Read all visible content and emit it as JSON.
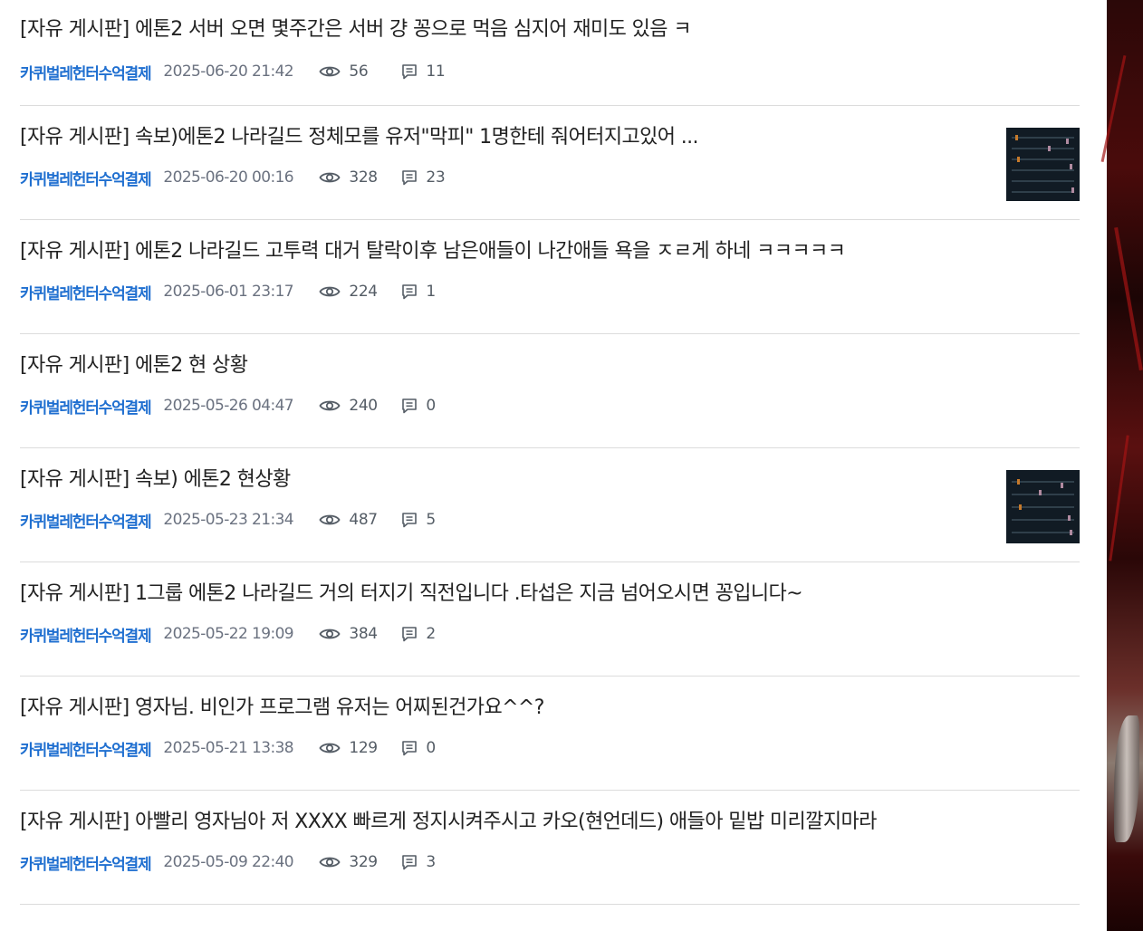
{
  "posts": [
    {
      "title": "[자유 게시판] 에톤2 서버 오면 몇주간은 서버 걍 꽁으로 먹음 심지어 재미도 있음 ㅋ",
      "author": "카퀴벌레헌터수억결제",
      "date": "2025-06-20 21:42",
      "views": "56",
      "comments": "11",
      "has_thumb": false
    },
    {
      "title": "[자유 게시판] 속보)에톤2 나라길드 정체모를 유저\"막피\" 1명한테 줘어터지고있어 ...",
      "author": "카퀴벌레헌터수억결제",
      "date": "2025-06-20 00:16",
      "views": "328",
      "comments": "23",
      "has_thumb": true
    },
    {
      "title": "[자유 게시판] 에톤2 나라길드 고투력 대거 탈락이후 남은애들이 나간애들 욕을 ㅈㄹ게 하네 ㅋㅋㅋㅋㅋ",
      "author": "카퀴벌레헌터수억결제",
      "date": "2025-06-01 23:17",
      "views": "224",
      "comments": "1",
      "has_thumb": false
    },
    {
      "title": "[자유 게시판] 에톤2 현 상황",
      "author": "카퀴벌레헌터수억결제",
      "date": "2025-05-26 04:47",
      "views": "240",
      "comments": "0",
      "has_thumb": false
    },
    {
      "title": "[자유 게시판] 속보) 에톤2 현상황",
      "author": "카퀴벌레헌터수억결제",
      "date": "2025-05-23 21:34",
      "views": "487",
      "comments": "5",
      "has_thumb": true
    },
    {
      "title": "[자유 게시판] 1그룹 에톤2 나라길드 거의 터지기 직전입니다 .타섭은 지금 넘어오시면 꽁입니다~",
      "author": "카퀴벌레헌터수억결제",
      "date": "2025-05-22 19:09",
      "views": "384",
      "comments": "2",
      "has_thumb": false
    },
    {
      "title": "[자유 게시판] 영자님. 비인가 프로그램 유저는 어찌된건가요^^?",
      "author": "카퀴벌레헌터수억결제",
      "date": "2025-05-21 13:38",
      "views": "129",
      "comments": "0",
      "has_thumb": false
    },
    {
      "title": "[자유 게시판] 아빨리 영자님아 저 XXXX 빠르게 정지시켜주시고 카오(현언데드) 애들아 밑밥 미리깔지마라",
      "author": "카퀴벌레헌터수억결제",
      "date": "2025-05-09 22:40",
      "views": "329",
      "comments": "3",
      "has_thumb": false
    }
  ],
  "icons": {
    "views": "eye-icon",
    "comments": "comment-icon"
  },
  "colors": {
    "author": "#1f6fd0",
    "meta": "#6b7280",
    "divider": "#dcdcdc"
  }
}
